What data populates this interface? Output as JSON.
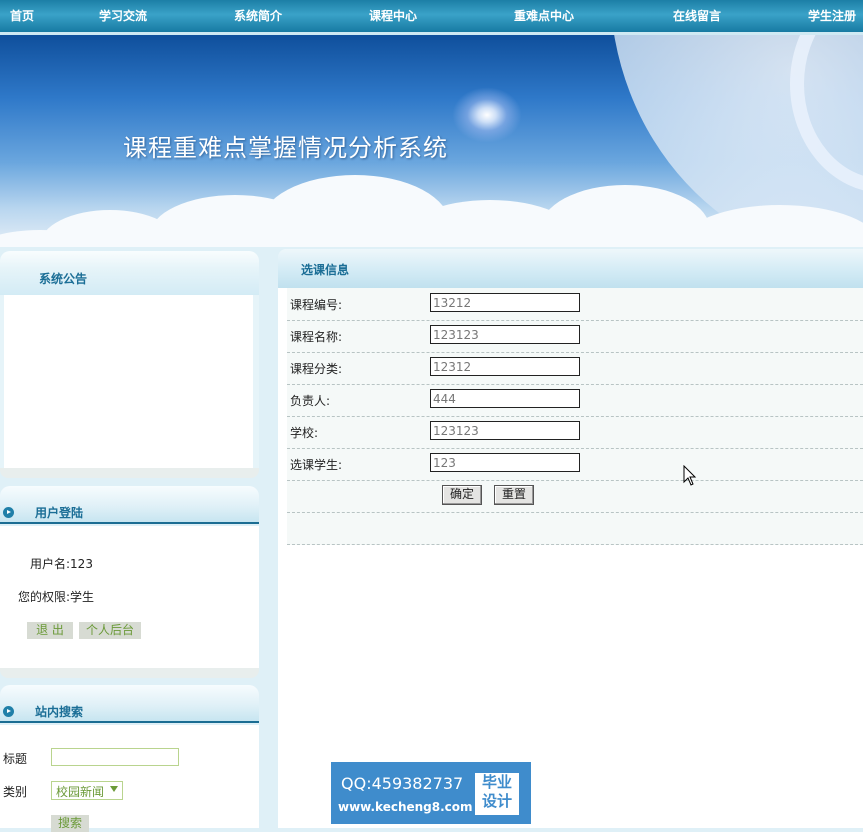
{
  "nav": {
    "items": [
      {
        "label": "首页"
      },
      {
        "label": "学习交流"
      },
      {
        "label": "系统简介"
      },
      {
        "label": "课程中心"
      },
      {
        "label": "重难点中心"
      },
      {
        "label": "在线留言"
      },
      {
        "label": "学生注册"
      }
    ]
  },
  "banner": {
    "title": "课程重难点掌握情况分析系统"
  },
  "sidebar": {
    "announcement": {
      "title": "系统公告"
    },
    "login": {
      "title": "用户登陆",
      "username_label": "用户名:",
      "username_value": "123",
      "role_label": "您的权限:",
      "role_value": "学生",
      "logout_label": "退 出",
      "backend_label": "个人后台"
    },
    "search": {
      "title": "站内搜索",
      "title_field_label": "标题",
      "title_field_value": "",
      "category_label": "类别",
      "category_selected": "校园新闻",
      "search_button_label": "搜索"
    }
  },
  "main": {
    "section_title": "选课信息",
    "fields": [
      {
        "label": "课程编号:",
        "value": "13212"
      },
      {
        "label": "课程名称:",
        "value": "123123"
      },
      {
        "label": "课程分类:",
        "value": "12312"
      },
      {
        "label": "负责人:",
        "value": "444"
      },
      {
        "label": "学校:",
        "value": "123123"
      },
      {
        "label": "选课学生:",
        "value": "123"
      }
    ],
    "confirm_label": "确定",
    "reset_label": "重置"
  },
  "watermark": {
    "qq": "QQ:459382737",
    "url": "www.kecheng8.com",
    "badge_line1": "毕业",
    "badge_line2": "设计"
  },
  "colors": {
    "nav_bg": "#1c7fa6",
    "header_text": "#1b6e96",
    "page_bg": "#dff0f7",
    "watermark_bg": "#3f8ccc"
  }
}
